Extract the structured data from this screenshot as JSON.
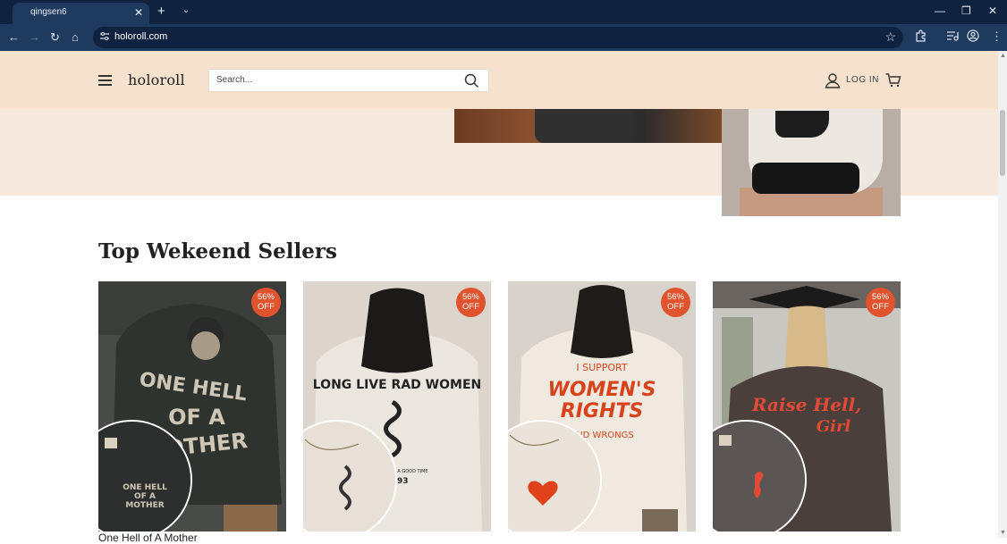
{
  "browser": {
    "tab_title": "qingsen6",
    "tab_close": "✕",
    "new_tab": "+",
    "tab_search": "⌄",
    "minimize": "—",
    "restore": "❐",
    "close": "✕",
    "back": "←",
    "forward": "→",
    "reload": "↻",
    "home": "⌂",
    "url": "holoroll.com",
    "bookmark": "☆",
    "menu": "⋮"
  },
  "header": {
    "logo": "holoroll",
    "search_placeholder": "Search...",
    "login_label": "LOG IN"
  },
  "section": {
    "title": "Top Wekeend Sellers"
  },
  "products": [
    {
      "badge_pct": "56%",
      "badge_off": "OFF",
      "shirt_color": "#2f3330",
      "bg_color": "#4a4d4a",
      "print": "ONE HELL OF A MOTHER",
      "print_color": "#cfc7b6",
      "inset_text": "ONE HELL OF A MOTHER",
      "name": "One Hell of A Mother"
    },
    {
      "badge_pct": "56%",
      "badge_off": "OFF",
      "shirt_color": "#ece7de",
      "bg_color": "#dcd6cc",
      "print": "LONG LIVE RAD WOMEN",
      "print_color": "#222222",
      "sub_print": "ONE HELL OF A GOOD TIME",
      "year": "1993"
    },
    {
      "badge_pct": "56%",
      "badge_off": "OFF",
      "shirt_color": "#efe9df",
      "bg_color": "#d9d4cb",
      "print_top": "I SUPPORT",
      "print": "WOMEN'S RIGHTS",
      "print_bottom": "AND WRONGS",
      "print_color": "#d9431c"
    },
    {
      "badge_pct": "56%",
      "badge_off": "OFF",
      "shirt_color": "#4a3f3a",
      "bg_color": "#c9c7c2",
      "print": "Raise Hell, Girl",
      "print_color": "#e14a35"
    }
  ]
}
